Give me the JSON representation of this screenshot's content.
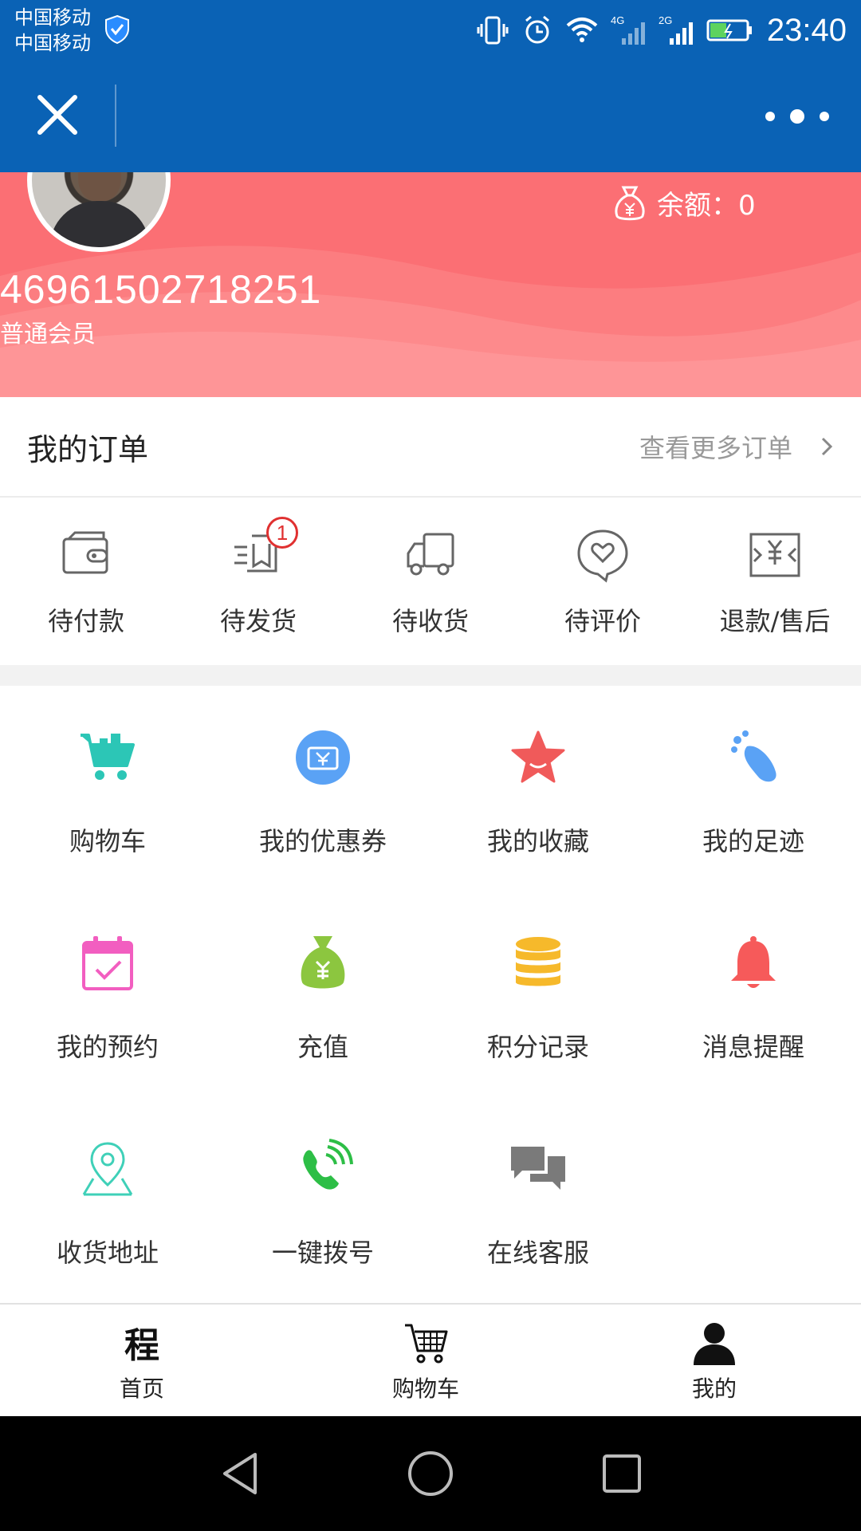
{
  "status_bar": {
    "carrier_line1": "中国移动",
    "carrier_line2": "中国移动",
    "net1": "4G",
    "net2": "2G",
    "time": "23:40"
  },
  "header": {
    "balance_text": "余额：0",
    "user_id": "46961502718251",
    "member_level": "普通会员"
  },
  "orders": {
    "title": "我的订单",
    "more_label": "查看更多订单",
    "items": [
      {
        "label": "待付款",
        "icon": "wallet-icon"
      },
      {
        "label": "待发货",
        "icon": "ship-icon",
        "badge": "1"
      },
      {
        "label": "待收货",
        "icon": "truck-icon"
      },
      {
        "label": "待评价",
        "icon": "review-icon"
      },
      {
        "label": "退款/售后",
        "icon": "refund-icon"
      }
    ]
  },
  "services": [
    {
      "label": "购物车",
      "icon": "cart-icon",
      "color": "#2cc6b6"
    },
    {
      "label": "我的优惠券",
      "icon": "coupon-icon",
      "color": "#5aa2f5"
    },
    {
      "label": "我的收藏",
      "icon": "star-icon",
      "color": "#f05a5a"
    },
    {
      "label": "我的足迹",
      "icon": "footprint-icon",
      "color": "#5aa2f5"
    },
    {
      "label": "我的预约",
      "icon": "calendar-icon",
      "color": "#f25ec0"
    },
    {
      "label": "充值",
      "icon": "moneybag-icon",
      "color": "#8cc63f"
    },
    {
      "label": "积分记录",
      "icon": "coins-icon",
      "color": "#f6b92b"
    },
    {
      "label": "消息提醒",
      "icon": "bell-icon",
      "color": "#f65a5a"
    },
    {
      "label": "收货地址",
      "icon": "location-icon",
      "color": "#3fd0b8"
    },
    {
      "label": "一键拨号",
      "icon": "phone-icon",
      "color": "#2dbe46"
    },
    {
      "label": "在线客服",
      "icon": "chat-icon",
      "color": "#7a7a7a"
    }
  ],
  "bottom_nav": [
    {
      "label": "首页",
      "icon": "home-icon"
    },
    {
      "label": "购物车",
      "icon": "cart-icon"
    },
    {
      "label": "我的",
      "icon": "user-icon"
    }
  ],
  "home_icon_glyph": "程",
  "colors": {
    "brand_blue": "#0a62b5",
    "header_pink": "#fb6f74",
    "badge_red": "#e03030"
  }
}
